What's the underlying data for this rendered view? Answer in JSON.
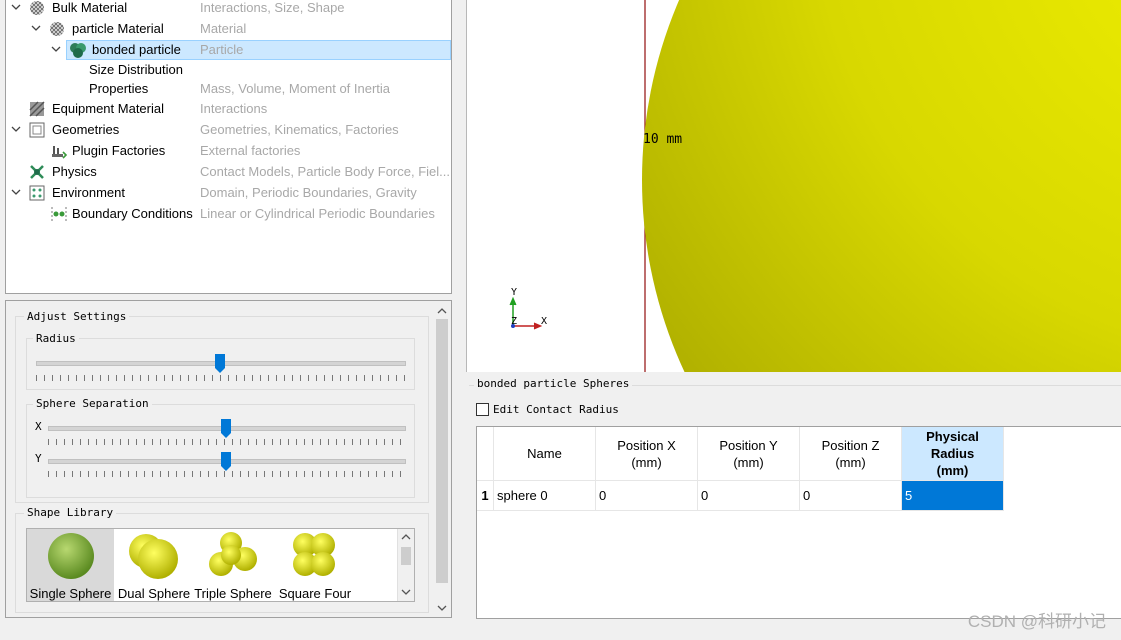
{
  "tree": {
    "rows": [
      {
        "label": "Bulk Material",
        "desc": "Interactions, Size, Shape",
        "icon": "checker-sphere-icon"
      },
      {
        "label": "particle Material",
        "desc": "Material",
        "icon": "checker-sphere-icon"
      },
      {
        "label": "bonded particle",
        "desc": "Particle",
        "icon": "bonded-particle-icon"
      },
      {
        "label": "Size Distribution",
        "desc": ""
      },
      {
        "label": "Properties",
        "desc": "Mass, Volume, Moment of Inertia"
      },
      {
        "label": "Equipment Material",
        "desc": "Interactions",
        "icon": "hatched-square-icon"
      },
      {
        "label": "Geometries",
        "desc": "Geometries, Kinematics, Factories",
        "icon": "geometry-box-icon"
      },
      {
        "label": "Plugin Factories",
        "desc": "External factories",
        "icon": "factory-icon"
      },
      {
        "label": "Physics",
        "desc": "Contact Models, Particle Body Force, Fiel...",
        "icon": "physics-icon"
      },
      {
        "label": "Environment",
        "desc": "Domain, Periodic Boundaries, Gravity",
        "icon": "environment-icon"
      },
      {
        "label": "Boundary Conditions",
        "desc": "Linear or Cylindrical Periodic Boundaries",
        "icon": "boundary-icon"
      }
    ]
  },
  "settings": {
    "title": "Adjust Settings",
    "radius_label": "Radius",
    "separation_label": "Sphere Separation",
    "x_label": "X",
    "y_label": "Y",
    "radius_value": 0.5,
    "sep_x_value": 0.5,
    "sep_y_value": 0.5
  },
  "shape_library": {
    "title": "Shape Library",
    "items": [
      {
        "label": "Single Sphere",
        "icon": "single-sphere-icon"
      },
      {
        "label": "Dual Sphere",
        "icon": "dual-sphere-icon"
      },
      {
        "label": "Triple Sphere",
        "icon": "triple-sphere-icon"
      },
      {
        "label": "Square Four",
        "icon": "square-four-icon"
      }
    ]
  },
  "viewport": {
    "dimension_label": "10 mm",
    "axis_x": "X",
    "axis_y": "Y",
    "axis_z": "Z",
    "sphere_color": "#d4d400"
  },
  "spheres": {
    "title": "bonded particle Spheres",
    "edit_contact_label": "Edit Contact Radius",
    "columns": [
      "Name",
      "Position X\n(mm)",
      "Position Y\n(mm)",
      "Position Z\n(mm)",
      "Physical Radius\n(mm)"
    ],
    "rows": [
      {
        "index": "1",
        "name": "sphere 0",
        "x": "0",
        "y": "0",
        "z": "0",
        "radius": "5"
      }
    ]
  },
  "watermark": "CSDN @科研小记"
}
